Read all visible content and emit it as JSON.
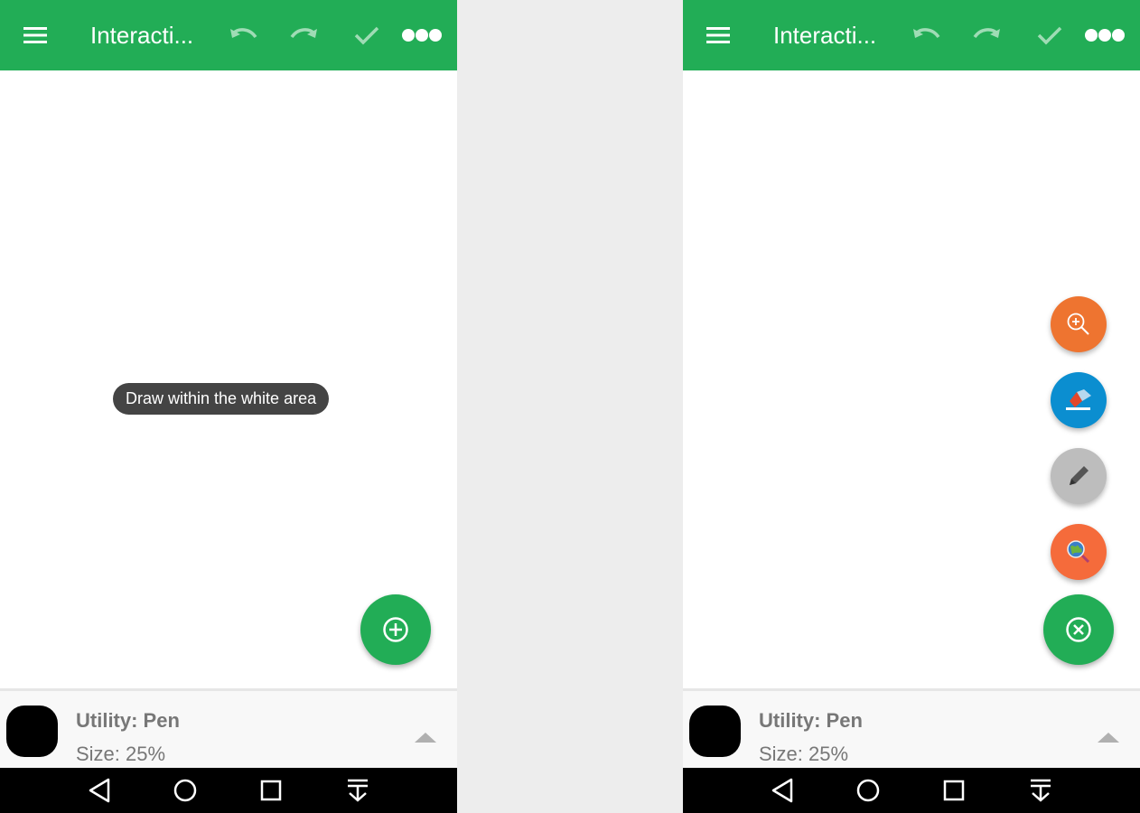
{
  "colors": {
    "primary": "#22ad56",
    "zoom_fab": "#ee7430",
    "eraser_fab": "#0b8ed0",
    "pen_fab": "#bdbdbd",
    "color_fab": "#f56b3b"
  },
  "screens": [
    {
      "app_bar": {
        "title": "Interacti..."
      },
      "toast": "Draw within the white area",
      "fab_icon": "plus-circle-icon",
      "bottom_panel": {
        "utility": "Utility: Pen",
        "size": "Size: 25%"
      }
    },
    {
      "app_bar": {
        "title": "Interacti..."
      },
      "mini_fabs": [
        "zoom-in-icon",
        "eraser-icon",
        "pencil-icon",
        "globe-search-icon"
      ],
      "fab_icon": "close-circle-icon",
      "bottom_panel": {
        "utility": "Utility: Pen",
        "size": "Size: 25%"
      }
    }
  ]
}
